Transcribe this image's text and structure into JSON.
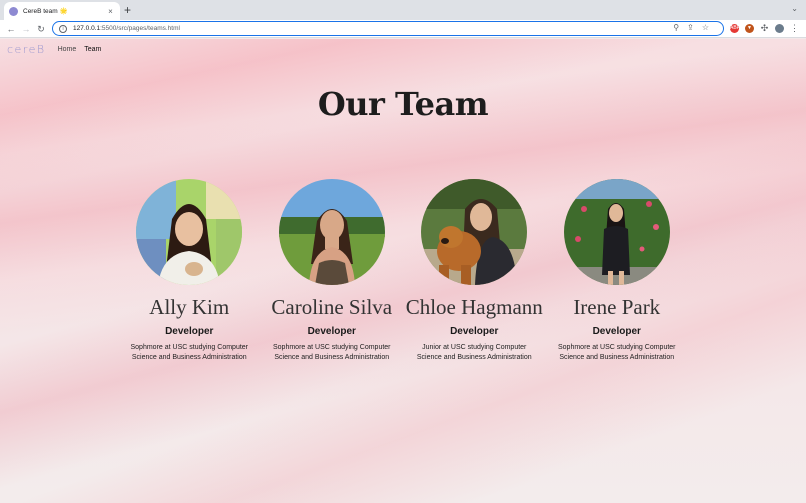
{
  "browser": {
    "tab_title": "CereB team 🌟",
    "tab_close": "×",
    "new_tab": "+",
    "url_host": "127.0.0.1:",
    "url_rest": "5500/src/pages/teams.html"
  },
  "nav": {
    "logo": "cereB",
    "links": [
      "Home",
      "Team"
    ]
  },
  "heading": "Our Team",
  "members": [
    {
      "name": "Ally Kim",
      "role": "Developer",
      "bio": "Sophmore at USC studying Computer Science and Business Administration"
    },
    {
      "name": "Caroline Silva",
      "role": "Developer",
      "bio": "Sophmore at USC studying Computer Science and Business Administration"
    },
    {
      "name": "Chloe Hagmann",
      "role": "Developer",
      "bio": "Junior at USC studying Computer Science and Business Administration"
    },
    {
      "name": "Irene Park",
      "role": "Developer",
      "bio": "Sophmore at USC studying Computer Science and Business Administration"
    }
  ],
  "colors": {
    "accent": "#1a73e8",
    "logo": "#9a96cf",
    "heading": "#1d1d1d"
  }
}
